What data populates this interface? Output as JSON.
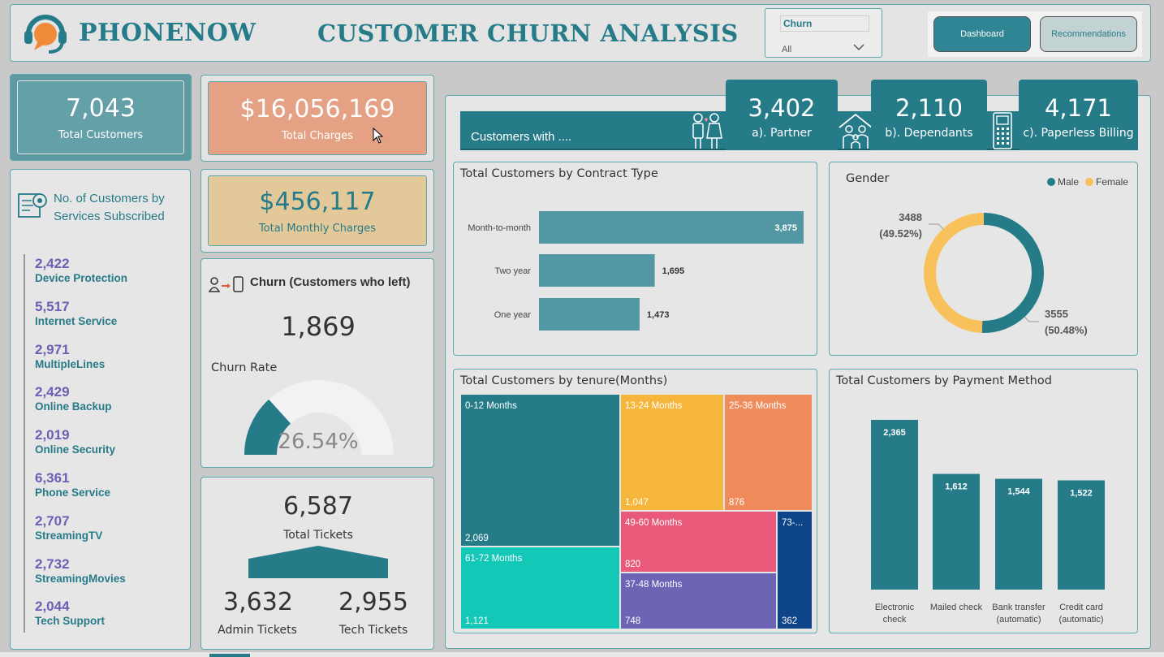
{
  "header": {
    "brand": "PHONENOW",
    "title": "CUSTOMER CHURN ANALYSIS",
    "slicer": {
      "label": "Churn",
      "value": "All"
    },
    "buttons": {
      "dashboard": "Dashboard",
      "recommendations": "Recommendations"
    }
  },
  "kpis": {
    "total_customers": {
      "value": "7,043",
      "label": "Total Customers"
    },
    "total_charges": {
      "value": "$16,056,169",
      "label": "Total Charges"
    },
    "total_monthly_charges": {
      "value": "$456,117",
      "label": "Total Monthly Charges"
    }
  },
  "services": {
    "title": "No. of Customers by Services Subscribed",
    "items": [
      {
        "value": "2,422",
        "label": "Device Protection"
      },
      {
        "value": "5,517",
        "label": "Internet Service"
      },
      {
        "value": "2,971",
        "label": "MultipleLines"
      },
      {
        "value": "2,429",
        "label": "Online Backup"
      },
      {
        "value": "2,019",
        "label": "Online Security"
      },
      {
        "value": "6,361",
        "label": "Phone Service"
      },
      {
        "value": "2,707",
        "label": "StreamingTV"
      },
      {
        "value": "2,732",
        "label": "StreamingMovies"
      },
      {
        "value": "2,044",
        "label": "Tech Support"
      }
    ]
  },
  "churn": {
    "title": "Churn (Customers who left)",
    "value": "1,869",
    "rate_label": "Churn Rate",
    "rate_value": "26.54%",
    "rate_fraction": 0.2654
  },
  "tickets": {
    "total_value": "6,587",
    "total_label": "Total Tickets",
    "admin_value": "3,632",
    "admin_label": "Admin Tickets",
    "tech_value": "2,955",
    "tech_label": "Tech Tickets"
  },
  "customers_with": {
    "header": "Customers with ....",
    "partner": {
      "value": "3,402",
      "label": "a). Partner"
    },
    "dependants": {
      "value": "2,110",
      "label": "b). Dependants"
    },
    "paperless": {
      "value": "4,171",
      "label": "c). Paperless Billing"
    }
  },
  "colors": {
    "teal": "#267b89",
    "bar": "#5397a4",
    "charges": "#e5a184",
    "monthly": "#e3c89a",
    "female": "#f8c15c",
    "male": "#267b89"
  },
  "chart_data": [
    {
      "type": "bar",
      "orientation": "horizontal",
      "title": "Total Customers by Contract Type",
      "categories": [
        "Month-to-month",
        "Two year",
        "One year"
      ],
      "values": [
        3875,
        1695,
        1473
      ],
      "labels": [
        "3,875",
        "1,695",
        "1,473"
      ]
    },
    {
      "type": "pie",
      "variant": "donut",
      "title": "Gender",
      "legend": "top-right",
      "series": [
        {
          "name": "Male",
          "value": 3555,
          "label": "3555",
          "pct": "(50.48%)"
        },
        {
          "name": "Female",
          "value": 3488,
          "label": "3488",
          "pct": "(49.52%)"
        }
      ]
    },
    {
      "type": "treemap",
      "title": "Total Customers by tenure(Months)",
      "items": [
        {
          "name": "0-12 Months",
          "value": 2069,
          "label": "2,069"
        },
        {
          "name": "61-72 Months",
          "value": 1121,
          "label": "1,121"
        },
        {
          "name": "13-24 Months",
          "value": 1047,
          "label": "1,047"
        },
        {
          "name": "25-36 Months",
          "value": 876,
          "label": "876"
        },
        {
          "name": "49-60 Months",
          "value": 820,
          "label": "820"
        },
        {
          "name": "37-48 Months",
          "value": 748,
          "label": "748"
        },
        {
          "name": "73-...",
          "value": 362,
          "label": "362"
        }
      ]
    },
    {
      "type": "bar",
      "title": "Total Customers by Payment Method",
      "categories": [
        "Electronic check",
        "Mailed check",
        "Bank transfer (automatic)",
        "Credit card (automatic)"
      ],
      "values": [
        2365,
        1612,
        1544,
        1522
      ],
      "labels": [
        "2,365",
        "1,612",
        "1,544",
        "1,522"
      ]
    }
  ]
}
